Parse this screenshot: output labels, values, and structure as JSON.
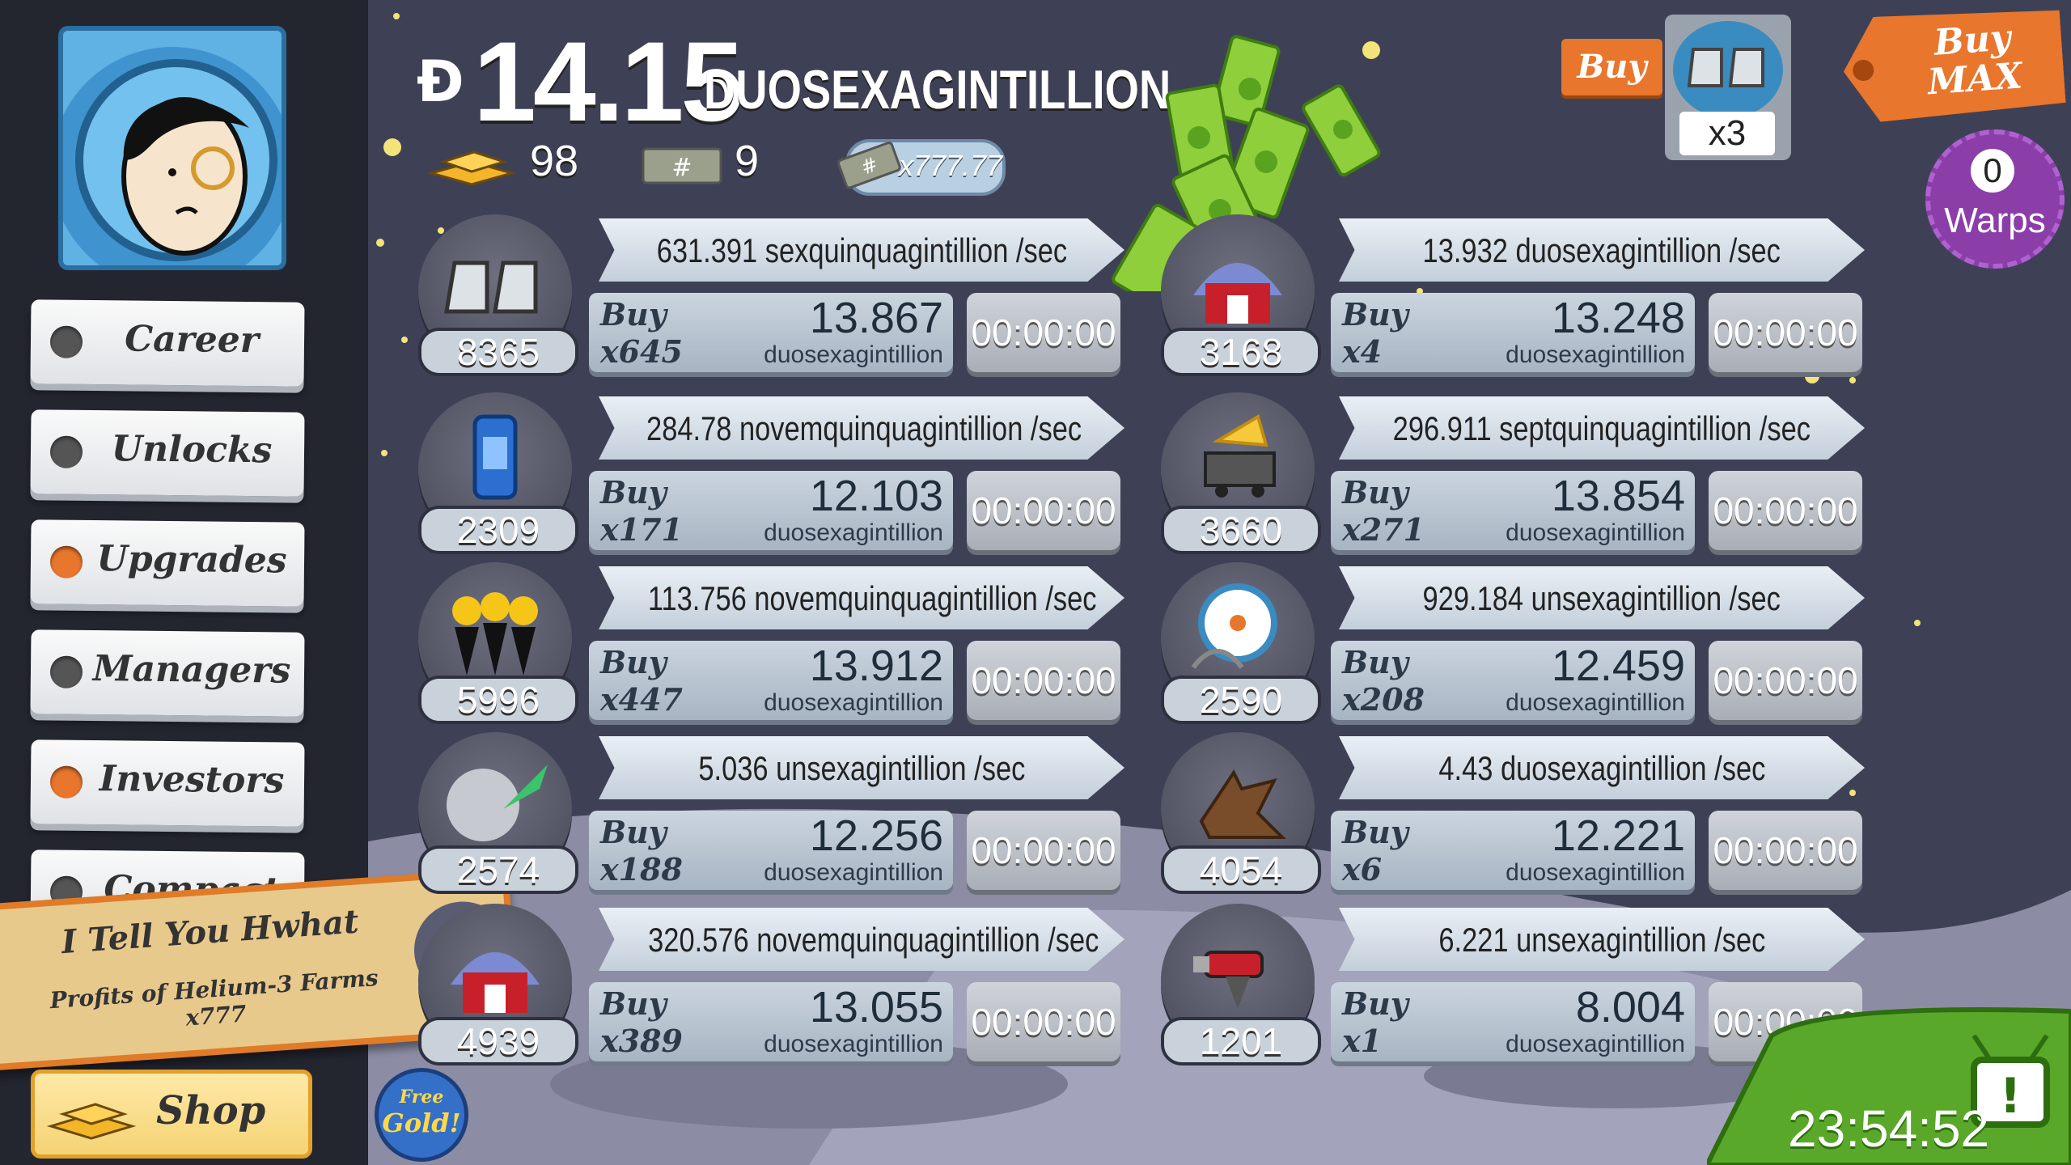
{
  "money": {
    "currency_symbol": "Đ",
    "amount": "14.15",
    "unit": "DUOSEXAGINTILLION"
  },
  "stats": {
    "gold": "98",
    "megatickets": "9",
    "multiplier": "x777.77"
  },
  "sidebar": {
    "items": [
      {
        "label": "Career",
        "dot": "grey"
      },
      {
        "label": "Unlocks",
        "dot": "grey"
      },
      {
        "label": "Upgrades",
        "dot": "orange"
      },
      {
        "label": "Managers",
        "dot": "grey"
      },
      {
        "label": "Investors",
        "dot": "orange"
      },
      {
        "label": "Compact",
        "dot": "grey"
      }
    ]
  },
  "shop": {
    "label": "Shop"
  },
  "free_gold": {
    "line1": "Free",
    "line2": "Gold!"
  },
  "notification": {
    "title": "I Tell You Hwhat",
    "subtitle": "Profits of Helium-3 Farms x777"
  },
  "top_right": {
    "buy_label": "Buy",
    "badge_multiplier": "x3",
    "buy_max_label": "Buy\nMAX",
    "warps_count": "0",
    "warps_label": "Warps"
  },
  "timer_bottom": "23:54:52",
  "businesses_left": [
    {
      "icon": "moon-boots-icon",
      "count": "8365",
      "rate": "631.391 sexquinquagintillion /sec",
      "buy_qty": "x645",
      "cost": "13.867",
      "cost_unit": "duosexagintillion",
      "timer": "00:00:00"
    },
    {
      "icon": "phone-booth-icon",
      "count": "2309",
      "rate": "284.78 novemquinquagintillion /sec",
      "buy_qty": "x171",
      "cost": "12.103",
      "cost_unit": "duosexagintillion",
      "timer": "00:00:00"
    },
    {
      "icon": "minions-icon",
      "count": "5996",
      "rate": "113.756 novemquinquagintillion /sec",
      "buy_qty": "x447",
      "cost": "13.912",
      "cost_unit": "duosexagintillion",
      "timer": "00:00:00"
    },
    {
      "icon": "moon-rocket-icon",
      "count": "2574",
      "rate": "5.036 unsexagintillion /sec",
      "buy_qty": "x188",
      "cost": "12.256",
      "cost_unit": "duosexagintillion",
      "timer": "00:00:00"
    },
    {
      "icon": "helium-farm-icon",
      "count": "4939",
      "rate": "320.576 novemquinquagintillion /sec",
      "buy_qty": "x389",
      "cost": "13.055",
      "cost_unit": "duosexagintillion",
      "timer": "00:00:00"
    }
  ],
  "businesses_right": [
    {
      "icon": "farm-dome-icon",
      "count": "3168",
      "rate": "13.932 duosexagintillion /sec",
      "buy_qty": "x4",
      "cost": "13.248",
      "cost_unit": "duosexagintillion",
      "timer": "00:00:00"
    },
    {
      "icon": "cheese-mine-icon",
      "count": "3660",
      "rate": "296.911 septquinquagintillion /sec",
      "buy_qty": "x271",
      "cost": "13.854",
      "cost_unit": "duosexagintillion",
      "timer": "00:00:00"
    },
    {
      "icon": "amusement-park-icon",
      "count": "2590",
      "rate": "929.184 unsexagintillion /sec",
      "buy_qty": "x208",
      "cost": "12.459",
      "cost_unit": "duosexagintillion",
      "timer": "00:00:00"
    },
    {
      "icon": "werewolf-icon",
      "count": "4054",
      "rate": "4.43 duosexagintillion /sec",
      "buy_qty": "x6",
      "cost": "12.221",
      "cost_unit": "duosexagintillion",
      "timer": "00:00:00"
    },
    {
      "icon": "ray-gun-icon",
      "count": "1201",
      "rate": "6.221 unsexagintillion /sec",
      "buy_qty": "x1",
      "cost": "8.004",
      "cost_unit": "duosexagintillion",
      "timer": "00:00:00"
    }
  ],
  "buy_label": "Buy"
}
